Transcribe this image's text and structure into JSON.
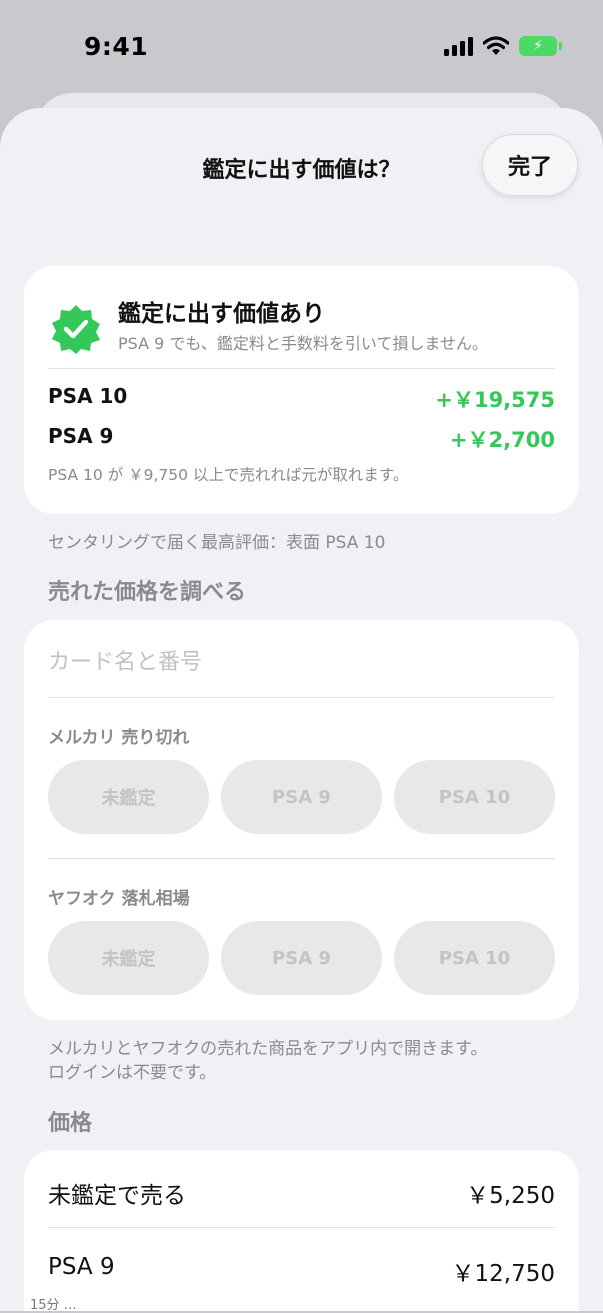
{
  "status_bar": {
    "time": "9:41"
  },
  "sheet": {
    "title": "鑑定に出す価値は？",
    "done_label": "完了"
  },
  "verdict": {
    "title": "鑑定に出す価値あり",
    "subtitle": "PSA 9 でも、鑑定料と手数料を引いて損しません。",
    "rows": [
      {
        "label": "PSA 10",
        "value": "+￥19,575"
      },
      {
        "label": "PSA 9",
        "value": "+￥2,700"
      }
    ],
    "note": "PSA 10 が ￥9,750 以上で売れれば元が取れます。",
    "accent_color": "#34c759"
  },
  "centering_caption": "センタリングで届く最高評価：表面 PSA 10",
  "sold_section": {
    "heading": "売れた価格を調べる",
    "search_placeholder": "カード名と番号",
    "groups": [
      {
        "label": "メルカリ 売り切れ",
        "buttons": [
          "未鑑定",
          "PSA 9",
          "PSA 10"
        ]
      },
      {
        "label": "ヤフオク 落札相場",
        "buttons": [
          "未鑑定",
          "PSA 9",
          "PSA 10"
        ]
      }
    ],
    "footnote_line1": "メルカリとヤフオクの売れた商品をアプリ内で開きます。",
    "footnote_line2": "ログインは不要です。"
  },
  "price_section": {
    "heading": "価格",
    "rows": [
      {
        "label": "未鑑定で売る",
        "value": "￥5,250"
      },
      {
        "label": "PSA 9",
        "value": "￥12,750"
      }
    ]
  },
  "peek_text": "15分 …"
}
